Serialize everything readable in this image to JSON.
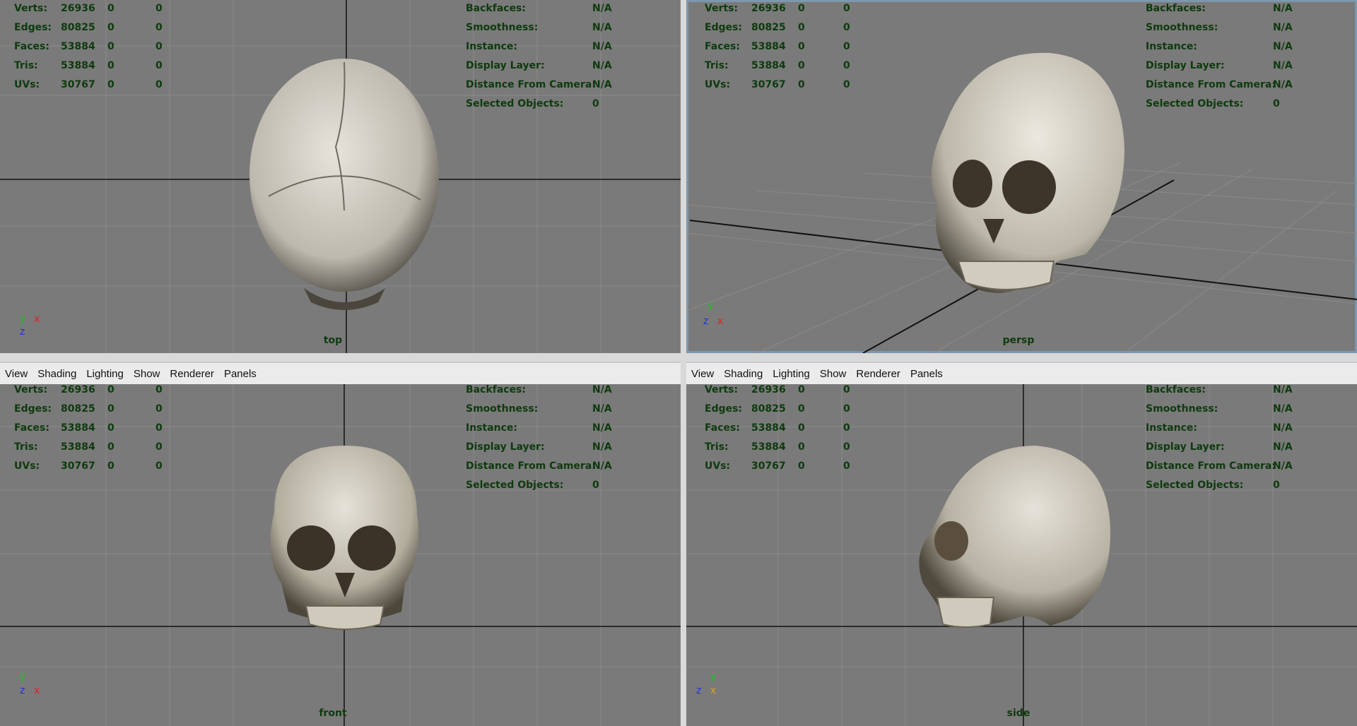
{
  "menu": {
    "view": "View",
    "shading": "Shading",
    "lighting": "Lighting",
    "show": "Show",
    "renderer": "Renderer",
    "panels": "Panels"
  },
  "hud": {
    "labels": {
      "verts": "Verts:",
      "edges": "Edges:",
      "faces": "Faces:",
      "tris": "Tris:",
      "uvs": "UVs:",
      "backfaces": "Backfaces:",
      "smoothness": "Smoothness:",
      "instance": "Instance:",
      "display_layer": "Display Layer:",
      "distance": "Distance From Camera:",
      "selected": "Selected Objects:"
    },
    "values": {
      "verts": "26936",
      "edges": "80825",
      "faces": "53884",
      "tris": "53884",
      "uvs": "30767",
      "zero": "0",
      "na": "N/A"
    }
  },
  "views": {
    "top": "top",
    "persp": "persp",
    "front": "front",
    "side": "side"
  },
  "axis": {
    "x": "x",
    "y": "y",
    "z": "z"
  },
  "colors": {
    "viewport_bg": "#7a7a7a",
    "hud_text": "#0e3a0e",
    "active_border": "#7d97ad",
    "axis_x": "#e02020",
    "axis_y": "#20c020",
    "axis_z": "#2030e0"
  }
}
